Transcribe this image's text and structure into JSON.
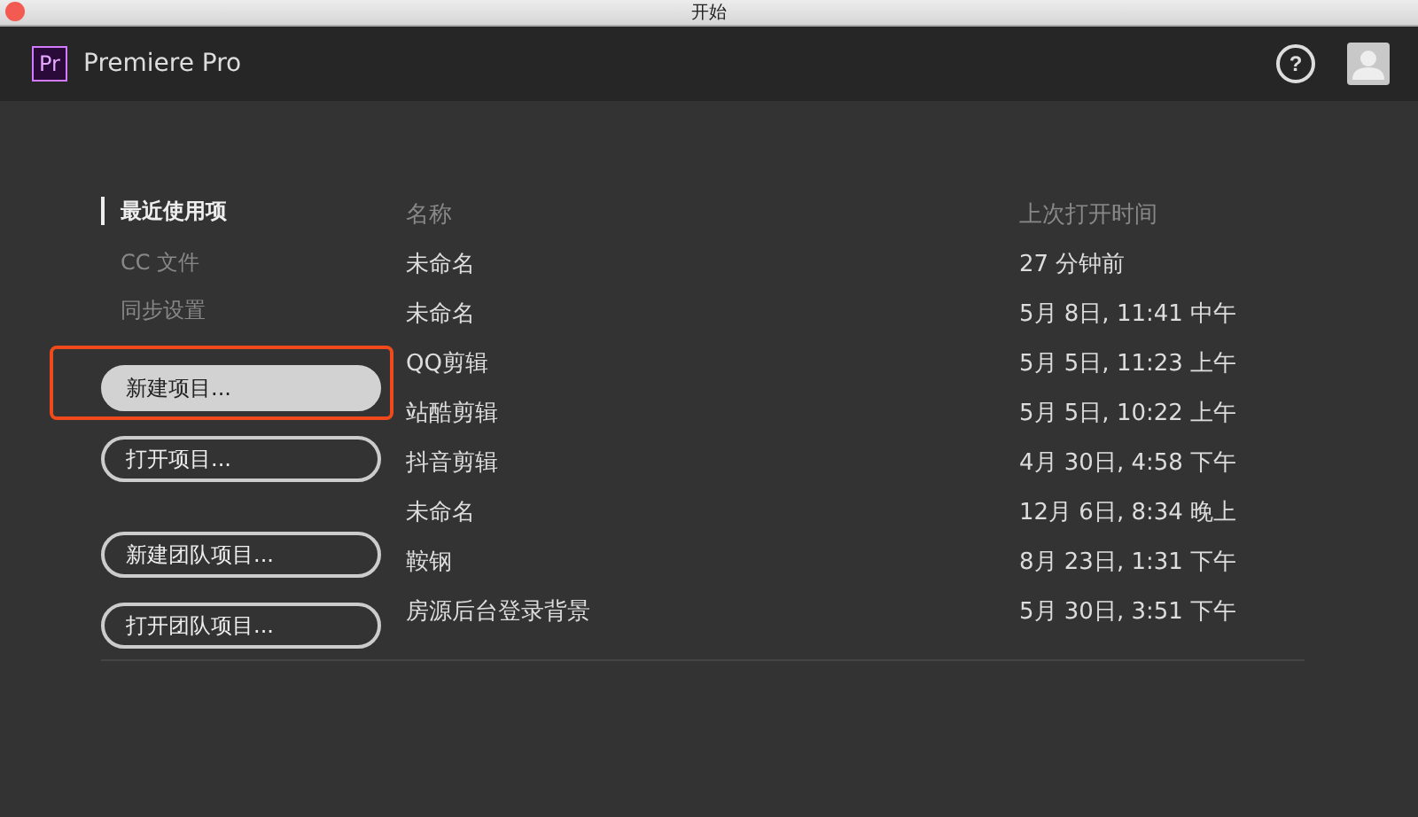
{
  "window": {
    "title": "开始"
  },
  "header": {
    "logo": "Pr",
    "app_name": "Premiere Pro",
    "help": "?"
  },
  "sidebar": {
    "items": [
      {
        "label": "最近使用项",
        "selected": true
      },
      {
        "label": "CC 文件",
        "selected": false
      },
      {
        "label": "同步设置",
        "selected": false
      }
    ]
  },
  "button_groups": [
    [
      {
        "label": "新建项目...",
        "primary": true,
        "highlighted": true
      },
      {
        "label": "打开项目...",
        "primary": false,
        "highlighted": false
      }
    ],
    [
      {
        "label": "新建团队项目...",
        "primary": false,
        "highlighted": false
      },
      {
        "label": "打开团队项目...",
        "primary": false,
        "highlighted": false
      }
    ]
  ],
  "table": {
    "columns": [
      "名称",
      "上次打开时间"
    ],
    "rows": [
      [
        "未命名",
        "27 分钟前"
      ],
      [
        "未命名",
        "5月 8日, 11:41 中午"
      ],
      [
        "QQ剪辑",
        "5月 5日, 11:23 上午"
      ],
      [
        "站酷剪辑",
        "5月 5日, 10:22 上午"
      ],
      [
        "抖音剪辑",
        "4月 30日, 4:58 下午"
      ],
      [
        "未命名",
        "12月 6日, 8:34 晚上"
      ],
      [
        "鞍钢",
        "8月 23日, 1:31 下午"
      ],
      [
        "房源后台登录背景",
        "5月 30日, 3:51 下午"
      ]
    ]
  }
}
